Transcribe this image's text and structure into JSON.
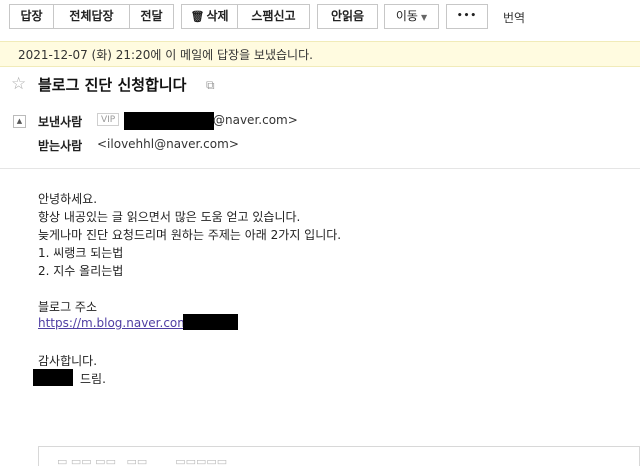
{
  "toolbar": {
    "reply": "답장",
    "reply_all": "전체답장",
    "forward": "전달",
    "delete": "삭제",
    "spam": "스팸신고",
    "unread": "안읽음",
    "move": "이동",
    "more": "•••",
    "translate": "번역"
  },
  "notice": {
    "text": "2021-12-07 (화) 21:20에 이 메일에 답장을 보냈습니다."
  },
  "mail": {
    "subject": "블로그 진단 신청합니다",
    "sender_label": "보낸사람",
    "vip": "VIP",
    "sender_domain": "@naver.com>",
    "recipient_label": "받는사람",
    "recipient": "<ilovehhl@naver.com>"
  },
  "body": {
    "greeting": "안녕하세요.",
    "line1": "항상 내공있는 글 읽으면서 많은 도움 얻고 있습니다.",
    "line2": "늦게나마 진단 요청드리며 원하는 주제는 아래 2가지 입니다.",
    "item1": "1. 씨랭크 되는법",
    "item2": "2. 지수 올리는법",
    "blog_label": "블로그 주소",
    "blog_url": "https://m.blog.naver.com/",
    "thanks": "감사합니다.",
    "sign_suffix": "드림."
  },
  "colors": {
    "notice_bg": "#fffbe0",
    "link": "#4f3ea3",
    "redaction": "#000000"
  },
  "icons": {
    "star": "star-icon",
    "trash": "trash-icon",
    "popout": "popout-icon",
    "collapse": "collapse-icon"
  }
}
